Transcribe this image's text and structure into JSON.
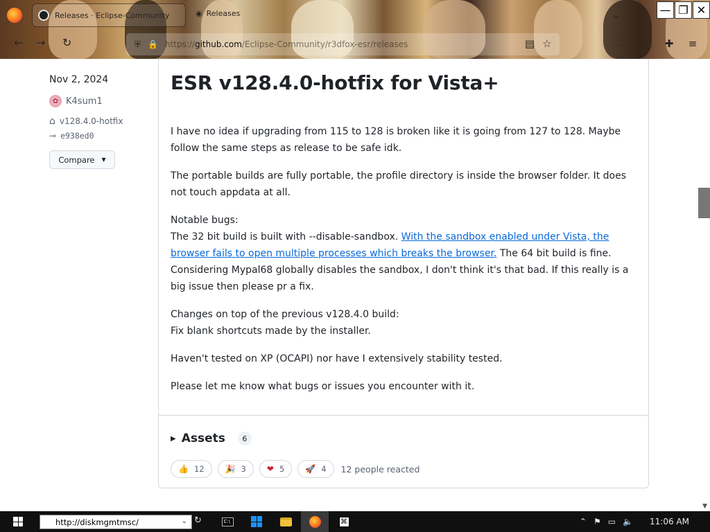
{
  "browser": {
    "tab_title": "Releases · Eclipse-Community",
    "tab2_title": "Releases",
    "url_host": "github.com",
    "url_path": "/Eclipse-Community/r3dfox-esr/releases",
    "url_prefix": "https://",
    "window_controls": {
      "minimize": "—",
      "maximize": "❐",
      "close": "✕"
    }
  },
  "release": {
    "date": "Nov 2, 2024",
    "author": "K4sum1",
    "tag": "v128.4.0-hotfix",
    "commit": "e938ed0",
    "compare_label": "Compare",
    "title": "ESR v128.4.0-hotfix for Vista+",
    "body": {
      "p1": "I have no idea if upgrading from 115 to 128 is broken like it is going from 127 to 128. Maybe follow the same steps as release to be safe idk.",
      "p2": "The portable builds are fully portable, the profile directory is inside the browser folder. It does not touch appdata at all.",
      "p3_heading": "Notable bugs:",
      "p3_pre": "The 32 bit build is built with --disable-sandbox. ",
      "p3_link": "With the sandbox enabled under Vista, the browser fails to open multiple processes which breaks the browser.",
      "p3_post": " The 64 bit build is fine. Considering Mypal68 globally disables the sandbox, I don't think it's that bad. If this really is a big issue then please pr a fix.",
      "p4_heading": "Changes on top of the previous v128.4.0 build:",
      "p4_item": "Fix blank shortcuts made by the installer.",
      "p5": "Haven't tested on XP (OCAPI) nor have I extensively stability tested.",
      "p6": "Please let me know what bugs or issues you encounter with it."
    },
    "assets_label": "Assets",
    "assets_count": "6",
    "reactions": [
      {
        "emoji": "👍",
        "count": "12"
      },
      {
        "emoji": "🎉",
        "count": "3"
      },
      {
        "emoji": "❤",
        "count": "5"
      },
      {
        "emoji": "🚀",
        "count": "4"
      }
    ],
    "reactions_summary": "12 people reacted"
  },
  "taskbar": {
    "address_value": "http://diskmgmtmsc/",
    "clock": "11:06 AM"
  }
}
